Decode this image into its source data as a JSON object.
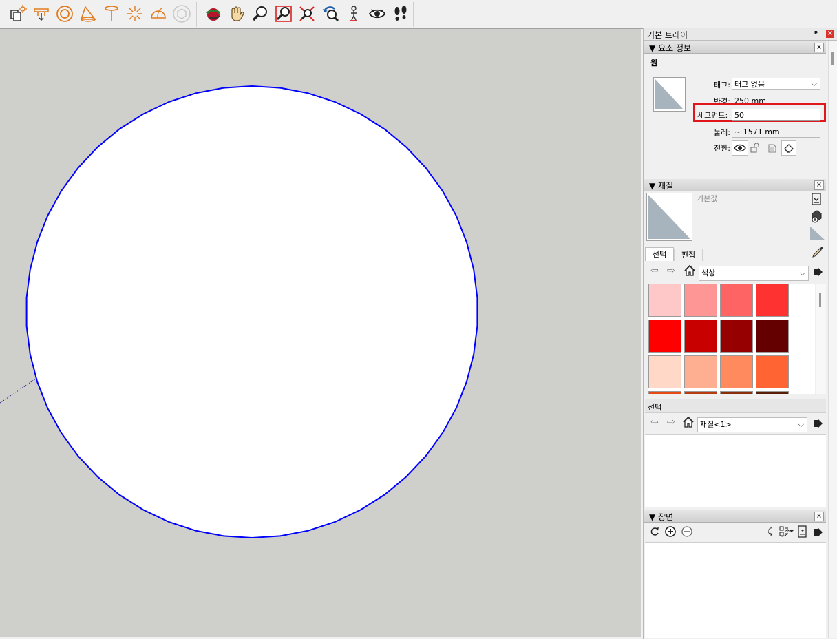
{
  "toolbar": {
    "left_icons": [
      "section-plane-icon",
      "section-fill-icon",
      "offset-rings-icon",
      "cone-icon",
      "lamp-icon",
      "sparkle-icon",
      "dome-icon",
      "cube-icon"
    ],
    "right_icons": [
      "orbit-icon",
      "pan-hand-icon",
      "zoom-icon",
      "zoom-window-icon",
      "zoom-extents-icon",
      "previous-view-icon",
      "position-camera-icon",
      "look-around-icon",
      "walk-icon"
    ]
  },
  "tray": {
    "title": "기본 트레이",
    "pin": "ᵖ",
    "close": "×"
  },
  "entity_info": {
    "header": "▼ 요소 정보",
    "close": "×",
    "entity_type": "원",
    "tag_label": "태그:",
    "tag_value": "태그 없음",
    "radius_label": "반경:",
    "radius_value": "250 mm",
    "segments_label": "세그먼트:",
    "segments_value": "50",
    "circumference_label": "둘레:",
    "circumference_value": "~ 1571 mm",
    "toggle_label": "전환:",
    "highlight_color": "#e0161b"
  },
  "materials": {
    "header": "▼ 재질",
    "close": "×",
    "material_name": "기본값",
    "tab_select": "선택",
    "tab_edit": "편집",
    "library": "색상",
    "swatches": [
      [
        "#ffc8c8",
        "#ff9696",
        "#ff6464",
        "#ff3232"
      ],
      [
        "#ff0000",
        "#c80000",
        "#960000",
        "#640000"
      ],
      [
        "#ffd8c8",
        "#ffaf91",
        "#ff8a5e",
        "#ff6432"
      ],
      [
        "#e84a13",
        "#b83c10",
        "#8a2e0c",
        "#5a1e08"
      ]
    ]
  },
  "secondary_select": {
    "label": "선택",
    "value": "재질<1>"
  },
  "scenes": {
    "header": "▼ 장면",
    "close": "×"
  },
  "colors": {
    "circle_edge": "#0000ff",
    "viewport_bg": "#cfcfcb"
  }
}
